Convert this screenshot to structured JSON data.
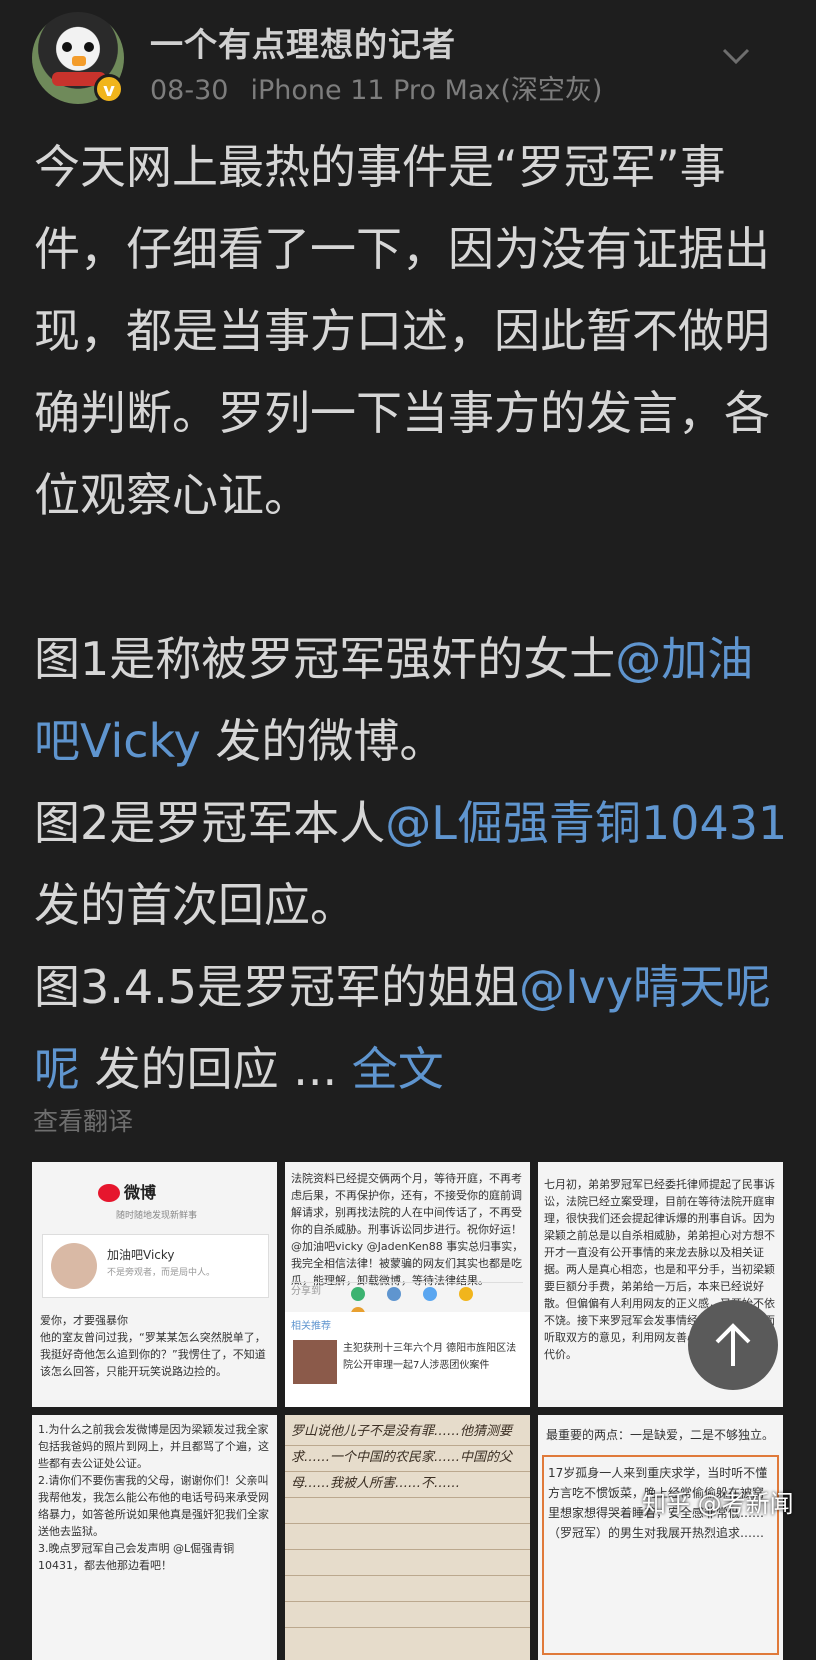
{
  "header": {
    "username": "一个有点理想的记者",
    "date": "08-30",
    "device": "iPhone 11 Pro Max(深空灰)",
    "verified_icon": "v-badge-icon",
    "menu_icon": "chevron-down-icon"
  },
  "post": {
    "para1": "今天网上最热的事件是“罗冠军”事件，仔细看了一下，因为没有证据出现，都是当事方口述，因此暂不做明确判断。罗列一下当事方的发言，各位观察心证。",
    "line1_pre": "图1是称被罗冠军强奸的女士",
    "line1_mention": "@加油吧Vicky",
    "line1_post": " 发的微博。",
    "line2_pre": "图2是罗冠军本人",
    "line2_mention": "@L倔强青铜10431",
    "line2_post": " 发的首次回应。",
    "line3_pre": "图3.4.5是罗冠军的姐姐",
    "line3_mention": "@Ivy晴天呢呢",
    "line3_post": " 发的回应 ... ",
    "full_text": "全文"
  },
  "translate": "查看翻译",
  "images": {
    "t1": {
      "logo": "微博",
      "logo_sub": "随时随地发现新鲜事",
      "profile_name": "加油吧Vicky",
      "profile_desc": "不是旁观者，而是局中人。",
      "body": "爱你，才要强暴你\n他的室友曾问过我，“罗某某怎么突然脱单了，我挺好奇他怎么追到你的？”我愣住了，不知道该怎么回答，只能开玩笑说路边捡的。"
    },
    "t2": {
      "body": "法院资料已经提交俩两个月，等待开庭，不再考虑后果，不再保护你，还有，不接受你的庭前调解请求，别再找法院的人在中间传话了，不再受你的自杀威胁。刑事诉讼同步进行。祝你好运！@加油吧vicky @JadenKen88 事实总归事实，我完全相信法律！被蒙骗的网友们其实也都是吃瓜，能理解，卸载微博，等待法律结果。",
      "share_label": "分享到",
      "related_title": "相关推荐",
      "related_text": "主犯获刑十三年六个月 德阳市旌阳区法院公开审理一起7人涉恶团伙案件"
    },
    "t3": {
      "body": "七月初，弟弟罗冠军已经委托律师提起了民事诉讼，法院已经立案受理，目前在等待法院开庭审理，很快我们还会提起律诉爆的刑事自诉。因为梁颖之前总是以自杀相威胁，弟弟担心对方想不开才一直没有公开事情的来龙去脉以及相关证据。两人是真心相恋，也是和平分手，当初梁颖要巨额分手费，弟弟给一万后，本来已经说好散。但偏偏有人利用网友的正义感，又开始不依不饶。接下来罗冠军会发事情经过的声明，全面听取双方的意见，利用网友善心的人设完全付出代价。"
    },
    "t4": {
      "body": "1.为什么之前我会发微博是因为梁颖发过我全家包括我爸妈的照片到网上，并且都骂了个遍，这些都有去公证处公证。\n2.请你们不要伤害我的父母，谢谢你们！父亲叫我帮他发，我怎么能公布他的电话号码来承受网络暴力，如答爸所说如果他真是强奸犯我们全家送他去监狱。\n3.晚点罗冠军自己会发声明 @L倔强青铜10431，都去他那边看吧！"
    },
    "t5": {
      "body": "罗山说他儿子不是没有罪……他猜测要求……一个中国的农民家……中国的父母……我被人所害……不……"
    },
    "t6": {
      "heading": "最重要的两点：一是缺爱，二是不够独立。",
      "body": "17岁孤身一人来到重庆求学，当时听不懂方言吃不惯饭菜，晚上经常偷偷躲在被窝里想家想得哭着睡着，安全感非常低……（罗冠军）的男生对我展开热烈追求……"
    }
  },
  "fab": {
    "icon": "arrow-up-icon"
  },
  "watermark": "知乎 @考新闻",
  "colors": {
    "background": "#1e1e1e",
    "mention": "#5f95cf",
    "text": "#d6d6d6",
    "muted": "#7d7d7d"
  }
}
